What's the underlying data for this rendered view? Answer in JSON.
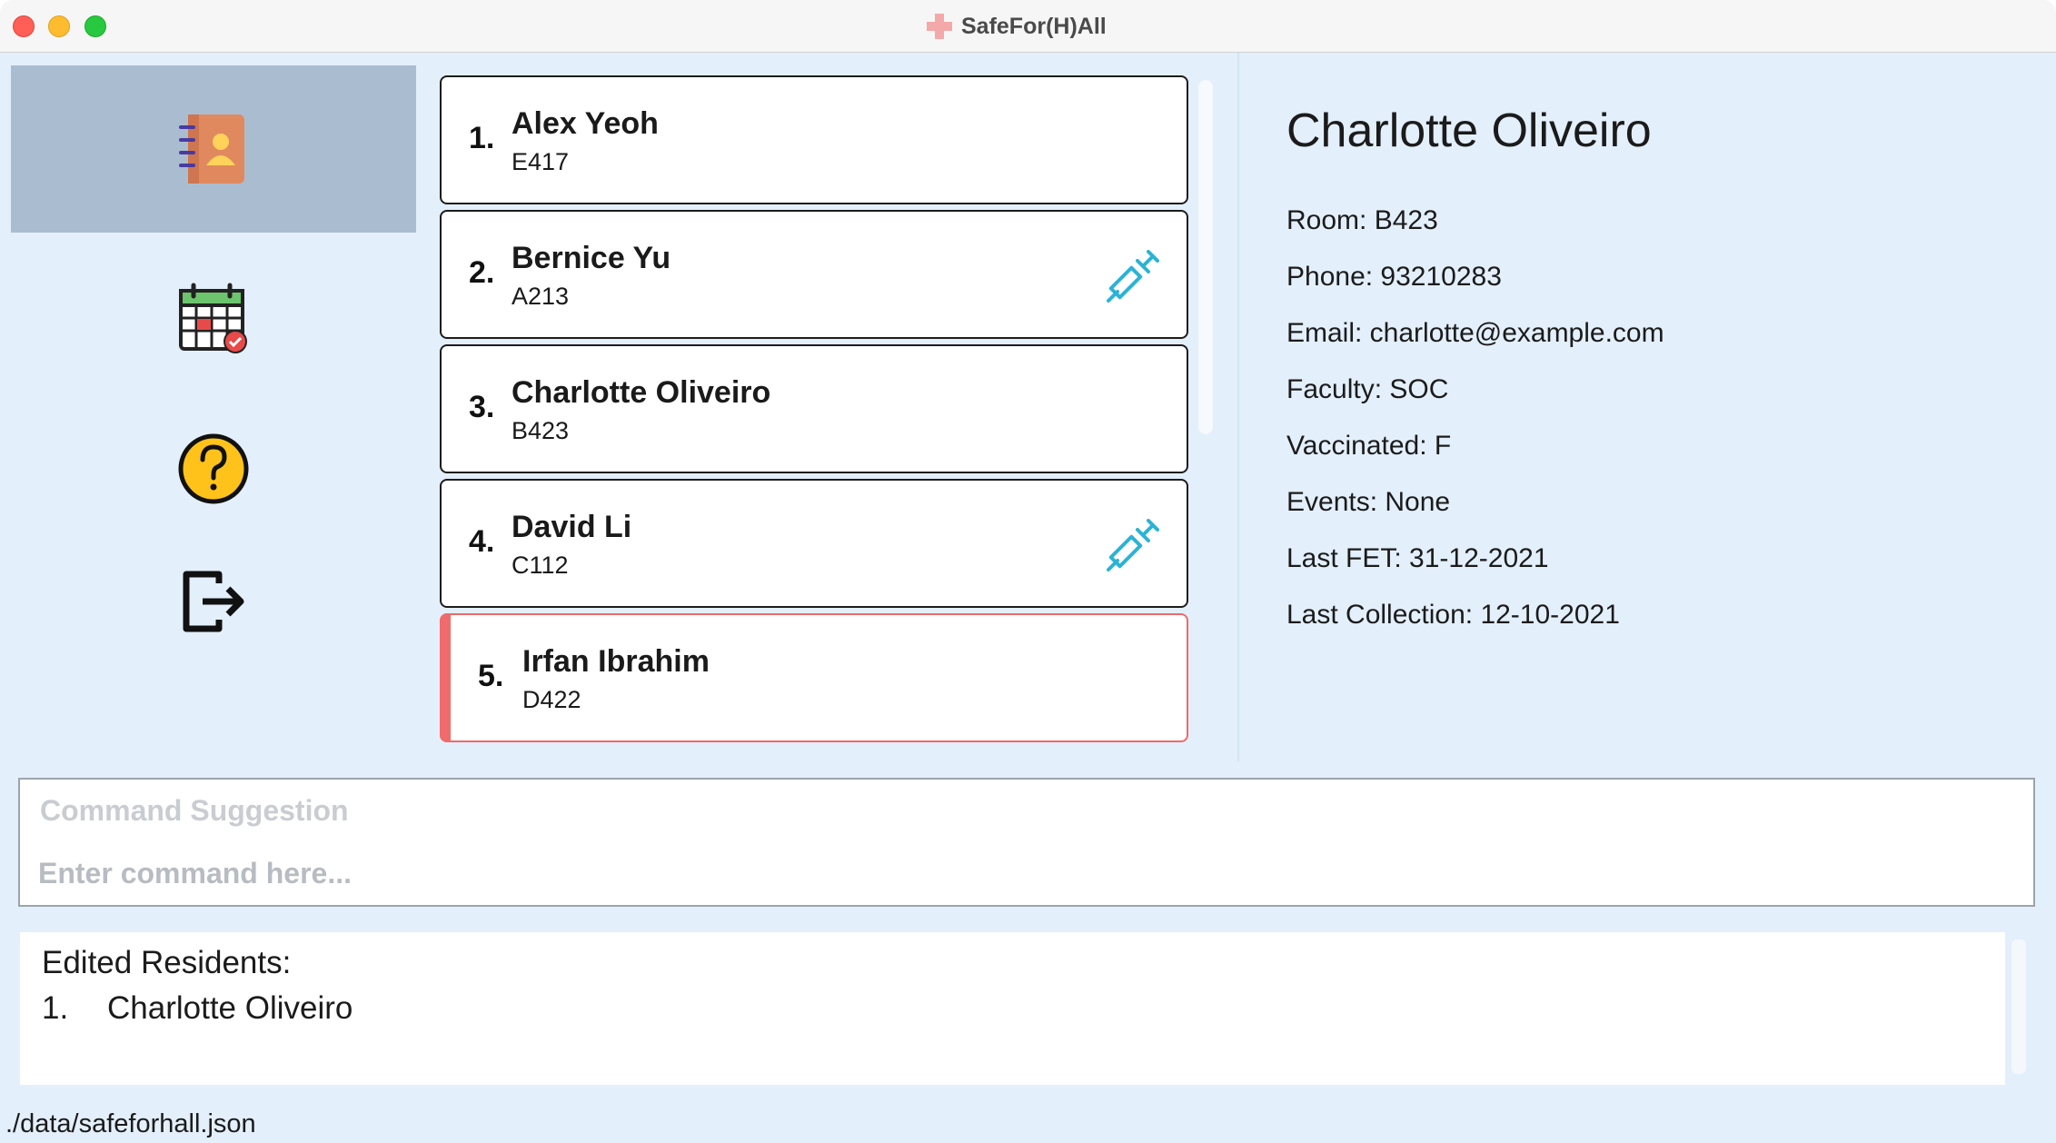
{
  "window": {
    "title": "SafeFor(H)All"
  },
  "sidebar": {
    "items": [
      {
        "icon": "contacts-book-icon",
        "active": true
      },
      {
        "icon": "calendar-icon",
        "active": false
      },
      {
        "icon": "help-icon",
        "active": false
      },
      {
        "icon": "exit-icon",
        "active": false
      }
    ]
  },
  "residents": [
    {
      "index": "1.",
      "name": "Alex Yeoh",
      "room": "E417",
      "vaccinated": false,
      "flagged": false
    },
    {
      "index": "2.",
      "name": "Bernice Yu",
      "room": "A213",
      "vaccinated": true,
      "flagged": false
    },
    {
      "index": "3.",
      "name": "Charlotte Oliveiro",
      "room": "B423",
      "vaccinated": false,
      "flagged": false
    },
    {
      "index": "4.",
      "name": "David Li",
      "room": "C112",
      "vaccinated": true,
      "flagged": false
    },
    {
      "index": "5.",
      "name": "Irfan Ibrahim",
      "room": "D422",
      "vaccinated": false,
      "flagged": true
    }
  ],
  "detail": {
    "name": "Charlotte Oliveiro",
    "room": "Room: B423",
    "phone": "Phone: 93210283",
    "email": "Email: charlotte@example.com",
    "faculty": "Faculty: SOC",
    "vaccinated": "Vaccinated: F",
    "events": "Events: None",
    "last_fet": "Last FET: 31-12-2021",
    "last_collection": "Last Collection: 12-10-2021"
  },
  "command": {
    "suggestion": "Command Suggestion",
    "value": "",
    "placeholder": "Enter command here..."
  },
  "result": {
    "title": "Edited Residents:",
    "items": [
      {
        "index": "1.",
        "name": "Charlotte Oliveiro"
      }
    ]
  },
  "status": {
    "file_path": "./data/safeforhall.json"
  },
  "colors": {
    "background": "#e3effb",
    "active_nav": "#aabdd0",
    "flag": "#f06b6b",
    "vaccine": "#2bb3d6"
  }
}
